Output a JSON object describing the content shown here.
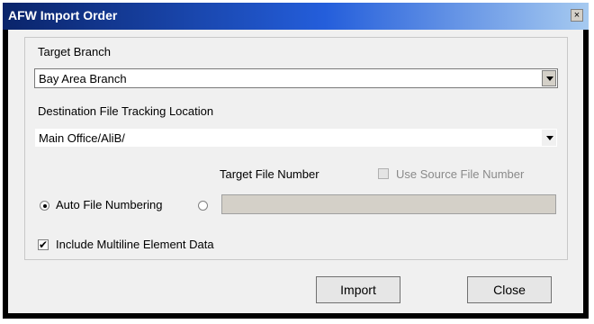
{
  "window": {
    "title": "AFW Import Order",
    "close_glyph": "×"
  },
  "form": {
    "target_branch": {
      "label": "Target Branch",
      "selected": "Bay Area Branch"
    },
    "destination": {
      "label": "Destination File Tracking Location",
      "selected": "Main Office/AliB/"
    },
    "target_file_number_label": "Target File Number",
    "use_source_file_number": {
      "label": "Use Source File Number",
      "checked": false,
      "enabled": false
    },
    "auto_file_numbering": {
      "label": "Auto File Numbering",
      "selected": true
    },
    "target_file_number_radio_selected": false,
    "target_file_number_value": "",
    "include_multiline": {
      "label": "Include Multiline Element Data",
      "checked": true,
      "check_glyph": "✔"
    }
  },
  "buttons": {
    "import": "Import",
    "close": "Close"
  }
}
